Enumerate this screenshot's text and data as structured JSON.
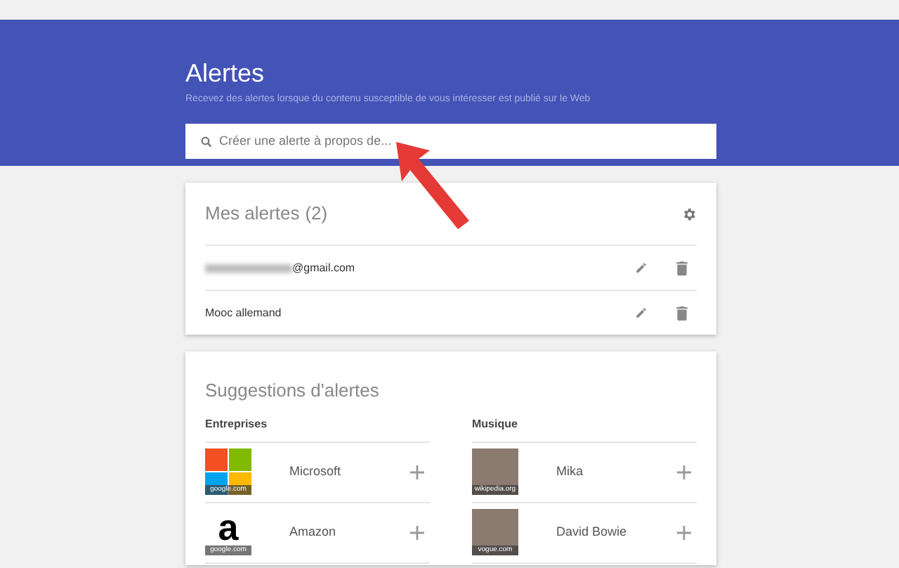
{
  "header": {
    "title": "Alertes",
    "subtitle": "Recevez des alertes lorsque du contenu susceptible de vous intéresser est publié sur le Web"
  },
  "search": {
    "placeholder": "Créer une alerte à propos de..."
  },
  "my_alerts": {
    "title": "Mes alertes",
    "count": "(2)",
    "items": [
      {
        "kind": "email",
        "label": "@gmail.com"
      },
      {
        "kind": "query",
        "label": "Mooc allemand"
      }
    ]
  },
  "suggestions": {
    "title": "Suggestions d'alertes",
    "columns": [
      {
        "heading": "Entreprises",
        "items": [
          {
            "kind": "windows-logo",
            "name": "Microsoft",
            "source": "google.com"
          },
          {
            "kind": "letter-logo",
            "logo_text": "a",
            "name": "Amazon",
            "source": "google.com"
          }
        ],
        "more_rows": true
      },
      {
        "heading": "Musique",
        "items": [
          {
            "kind": "photo",
            "name": "Mika",
            "source": "wikipedia.org"
          },
          {
            "kind": "photo",
            "name": "David Bowie",
            "source": "vogue.com"
          }
        ],
        "more_rows": true
      }
    ]
  }
}
